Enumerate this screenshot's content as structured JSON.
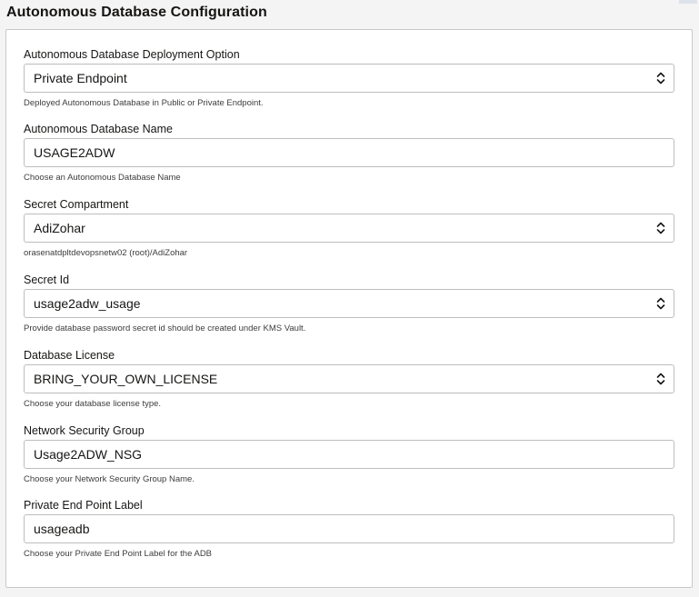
{
  "header": {
    "title": "Autonomous Database Configuration"
  },
  "fields": [
    {
      "label": "Autonomous Database Deployment Option",
      "value": "Private Endpoint",
      "type": "select",
      "help": "Deployed Autonomous Database in Public or Private Endpoint."
    },
    {
      "label": "Autonomous Database Name",
      "value": "USAGE2ADW",
      "type": "text",
      "help": "Choose an Autonomous Database Name"
    },
    {
      "label": "Secret Compartment",
      "value": "AdiZohar",
      "type": "select",
      "help": "orasenatdpltdevopsnetw02 (root)/AdiZohar"
    },
    {
      "label": "Secret Id",
      "value": "usage2adw_usage",
      "type": "select",
      "help": "Provide database password secret id should be created under KMS Vault."
    },
    {
      "label": "Database License",
      "value": "BRING_YOUR_OWN_LICENSE",
      "type": "select",
      "help": "Choose your database license type."
    },
    {
      "label": "Network Security Group",
      "value": "Usage2ADW_NSG",
      "type": "text",
      "help": "Choose your Network Security Group Name."
    },
    {
      "label": "Private End Point Label",
      "value": "usageadb",
      "type": "text",
      "help": "Choose your Private End Point Label for the ADB"
    }
  ],
  "icons": {
    "select_indicator": "chevron-up-down-icon"
  },
  "colors": {
    "border": "#bdbdbd",
    "text": "#161513",
    "help_text": "#3d3d3d",
    "background": "#f4f4f4"
  }
}
